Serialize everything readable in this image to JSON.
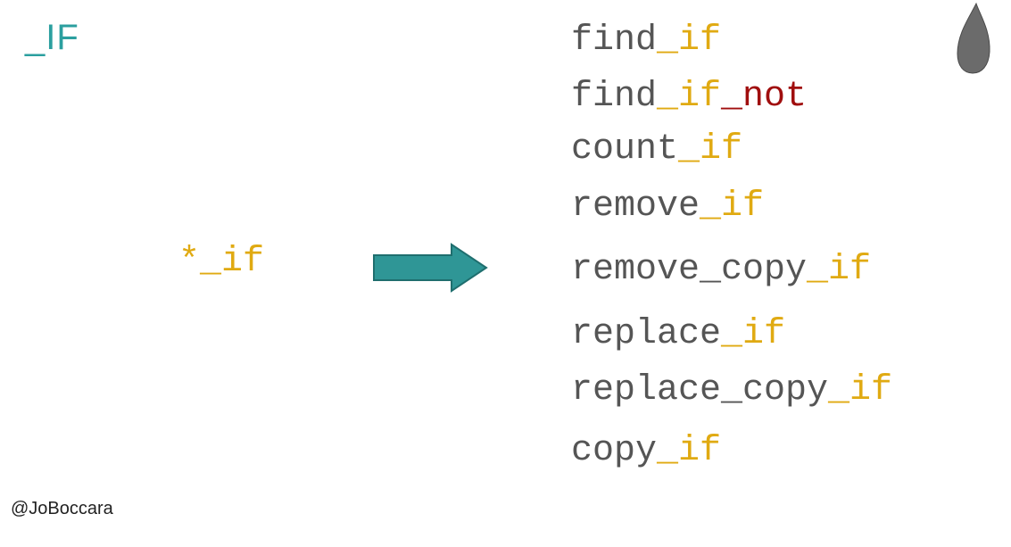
{
  "slide": {
    "title": "_IF",
    "pattern": "*_if",
    "handle": "@JoBoccara",
    "colors": {
      "title": "#2b9f9f",
      "arrow": "#2f9696",
      "base_text": "#555555",
      "suffix": "#e0aa12",
      "negation": "#a00e0e"
    },
    "icons": {
      "arrow": "right-arrow-icon",
      "drop": "drop-shape-icon"
    },
    "algorithms": [
      {
        "base": "find",
        "suffix": "_if",
        "extra": ""
      },
      {
        "base": "find",
        "suffix": "_if",
        "extra": "_not"
      },
      {
        "base": "count",
        "suffix": "_if",
        "extra": ""
      },
      {
        "base": "remove",
        "suffix": "_if",
        "extra": ""
      },
      {
        "base": "remove_copy",
        "suffix": "_if",
        "extra": ""
      },
      {
        "base": "replace",
        "suffix": "_if",
        "extra": ""
      },
      {
        "base": "replace_copy",
        "suffix": "_if",
        "extra": ""
      },
      {
        "base": "copy",
        "suffix": "_if",
        "extra": ""
      }
    ]
  }
}
